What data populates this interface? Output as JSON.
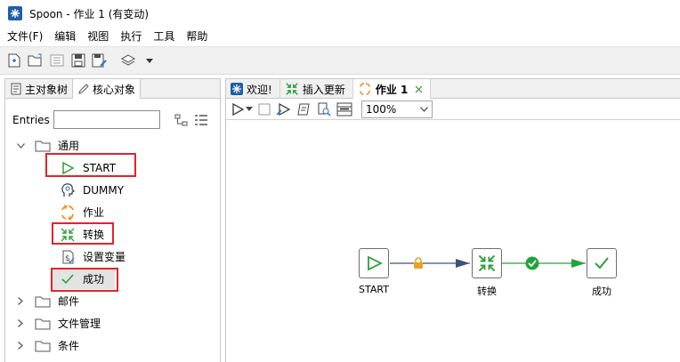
{
  "window": {
    "title": "Spoon - 作业 1 (有变动)"
  },
  "menu": {
    "items": [
      "文件(F)",
      "编辑",
      "视图",
      "执行",
      "工具",
      "帮助"
    ]
  },
  "left_panel": {
    "tabs": [
      {
        "label": "主对象树",
        "icon": "tree-icon"
      },
      {
        "label": "核心对象",
        "icon": "pencil-icon"
      }
    ],
    "entries_label": "Entries",
    "entries_value": "",
    "tree": {
      "general_folder": "通用",
      "items": [
        {
          "label": "START",
          "icon": "start-triangle-icon"
        },
        {
          "label": "DUMMY",
          "icon": "dummy-head-icon"
        },
        {
          "label": "作业",
          "icon": "job-icon"
        },
        {
          "label": "转换",
          "icon": "transform-icon"
        },
        {
          "label": "设置变量",
          "icon": "set-variable-icon"
        },
        {
          "label": "成功",
          "icon": "success-check-icon"
        }
      ],
      "other_folders": [
        "邮件",
        "文件管理",
        "条件"
      ]
    }
  },
  "right_panel": {
    "tabs": [
      {
        "label": "欢迎!",
        "icon": "spoon-icon"
      },
      {
        "label": "插入更新",
        "icon": "transform-icon"
      },
      {
        "label": "作业 1",
        "icon": "job-icon"
      }
    ],
    "zoom": "100%",
    "canvas": {
      "nodes": [
        {
          "label": "START",
          "icon": "start-triangle-icon"
        },
        {
          "label": "转换",
          "icon": "transform-icon"
        },
        {
          "label": "成功",
          "icon": "success-check-icon"
        }
      ],
      "hops": [
        {
          "from": "START",
          "to": "转换",
          "type": "unconditional",
          "icon": "lock-icon"
        },
        {
          "from": "转换",
          "to": "成功",
          "type": "success",
          "icon": "check-circle-icon"
        }
      ]
    }
  },
  "colors": {
    "highlight_box": "#e0242c",
    "start_green": "#2e9e3c",
    "hop_arrow": "#3c5278",
    "success_green": "#22a33a",
    "lock_orange": "#e8a322",
    "job_orange": "#f0902a"
  }
}
